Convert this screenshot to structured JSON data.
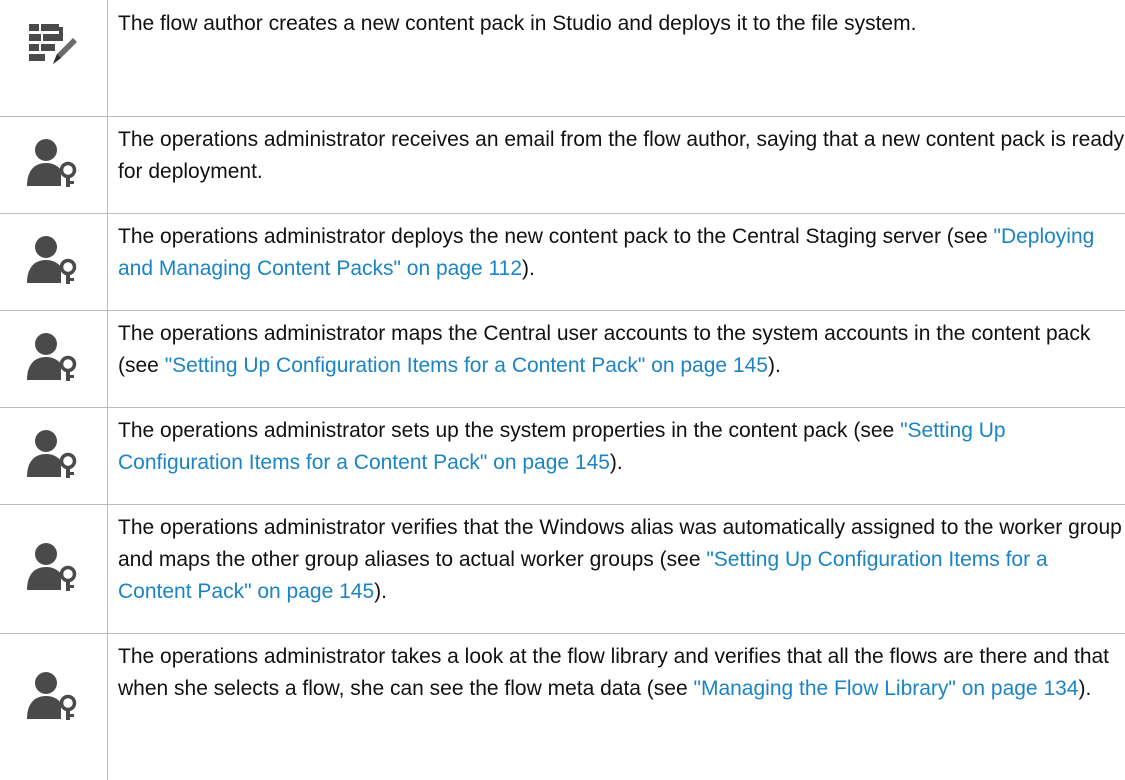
{
  "steps": [
    {
      "icon": "flow-author-icon",
      "text_before": "The flow author creates a new content pack in Studio and deploys it to the file system.",
      "link": "",
      "text_after": ""
    },
    {
      "icon": "operations-administrator-icon",
      "text_before": "The operations administrator receives an email from the flow author, saying that a new content pack is ready for deployment.",
      "link": "",
      "text_after": ""
    },
    {
      "icon": "operations-administrator-icon",
      "text_before": "The operations administrator deploys the new content pack to the Central Staging server (see ",
      "link": "\"Deploying and Managing Content Packs\" on page 112",
      "text_after": ")."
    },
    {
      "icon": "operations-administrator-icon",
      "text_before": "The operations administrator maps the Central user accounts to the system accounts in the content pack (see ",
      "link": "\"Setting Up Configuration Items for a Content Pack\" on page 145",
      "text_after": ")."
    },
    {
      "icon": "operations-administrator-icon",
      "text_before": "The operations administrator sets up the system properties in the content pack (see ",
      "link": "\"Setting Up Configuration Items for a Content Pack\" on page 145",
      "text_after": ")."
    },
    {
      "icon": "operations-administrator-icon",
      "text_before": "The operations administrator verifies that the Windows alias was automatically assigned to the worker group and maps the other group aliases to actual worker groups (see ",
      "link": "\"Setting Up Configuration Items for a Content Pack\" on page 145",
      "text_after": ")."
    },
    {
      "icon": "operations-administrator-icon",
      "text_before": "The operations administrator takes a look at the flow library and verifies that all the flows are there and that when she selects a flow, she can see the flow meta data (see ",
      "link": "\"Managing the Flow Library\" on page 134",
      "text_after": ")."
    }
  ],
  "colors": {
    "link": "#1b84c4",
    "icon_fill": "#4a4a4a",
    "rule": "#bdbdbd"
  }
}
